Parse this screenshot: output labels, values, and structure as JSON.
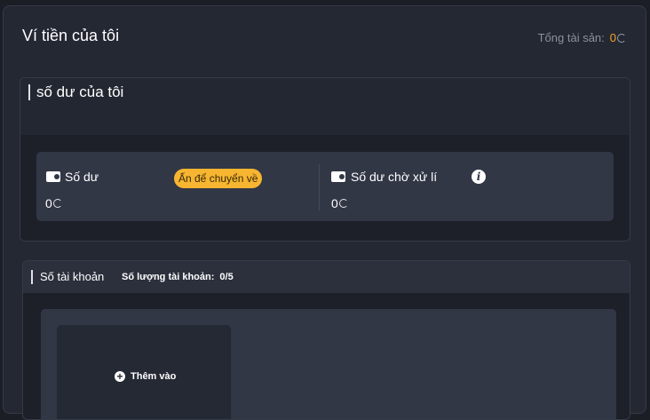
{
  "header": {
    "title": "Ví tiền của tôi",
    "total_label": "Tổng tài sản:",
    "total_value": "0"
  },
  "balance_section": {
    "title": "số dư của tôi",
    "balance": {
      "label": "Số dư",
      "transfer_button": "Ấn để chuyển về",
      "amount": "0",
      "icon": "wallet-icon"
    },
    "pending": {
      "label": "Số dư chờ xử lí",
      "amount": "0",
      "icon": "wallet-icon",
      "info_icon": "info-icon"
    }
  },
  "accounts_section": {
    "title": "Số tài khoản",
    "count_label": "Số lượng tài khoản:",
    "count_value": "0/5",
    "add_label": "Thêm vào"
  },
  "colors": {
    "accent": "#f5a623",
    "pill": "#f7b531",
    "panel": "#242833",
    "card": "#323746"
  }
}
